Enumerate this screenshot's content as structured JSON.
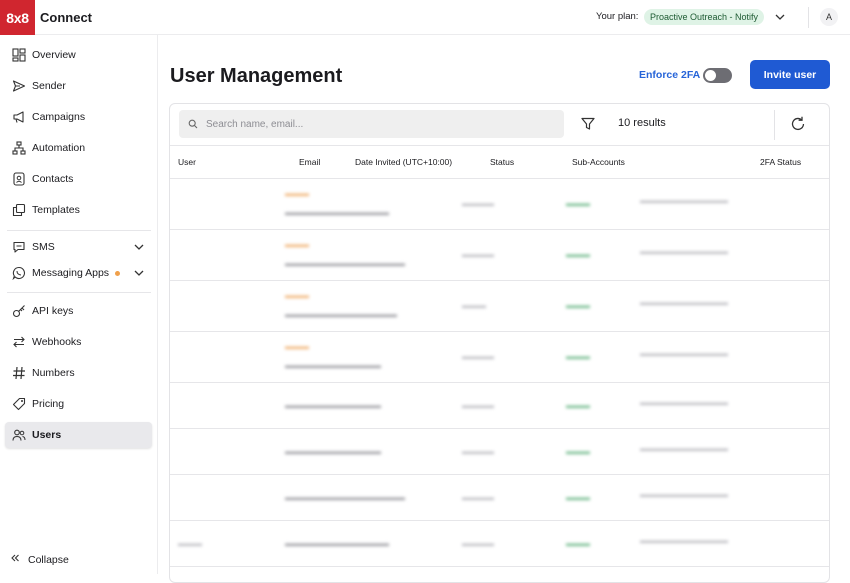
{
  "topbar": {
    "logo": "8x8",
    "app_name": "Connect",
    "plan_label": "Your plan:",
    "plan_value": "Proactive Outreach - Notify",
    "avatar": "A"
  },
  "sidebar": {
    "items": [
      {
        "label": "Overview",
        "icon": "overview-icon"
      },
      {
        "label": "Sender",
        "icon": "send-icon"
      },
      {
        "label": "Campaigns",
        "icon": "megaphone-icon"
      },
      {
        "label": "Automation",
        "icon": "flow-icon"
      },
      {
        "label": "Contacts",
        "icon": "contact-card-icon"
      },
      {
        "label": "Templates",
        "icon": "copy-icon"
      },
      {
        "label": "SMS",
        "icon": "chat-icon"
      },
      {
        "label": "Messaging Apps",
        "icon": "whatsapp-icon"
      },
      {
        "label": "API keys",
        "icon": "key-icon"
      },
      {
        "label": "Webhooks",
        "icon": "arrows-icon"
      },
      {
        "label": "Numbers",
        "icon": "hash-icon"
      },
      {
        "label": "Pricing",
        "icon": "tag-icon"
      },
      {
        "label": "Users",
        "icon": "users-icon"
      }
    ],
    "collapse": "Collapse",
    "active": "Users"
  },
  "main": {
    "title": "User Management",
    "enforce_2fa": "Enforce 2FA",
    "enforce_2fa_on": false,
    "invite_button": "Invite user",
    "search_placeholder": "Search name, email...",
    "results": "10 results",
    "columns": [
      "User",
      "Email",
      "Date Invited (UTC+10:00)",
      "Status",
      "Sub-Accounts",
      "2FA Status"
    ]
  },
  "colors": {
    "brand_red": "#d0262f",
    "primary_blue": "#1f5ad3",
    "link_blue": "#2664d8",
    "plan_badge_bg": "#dff3e6"
  }
}
